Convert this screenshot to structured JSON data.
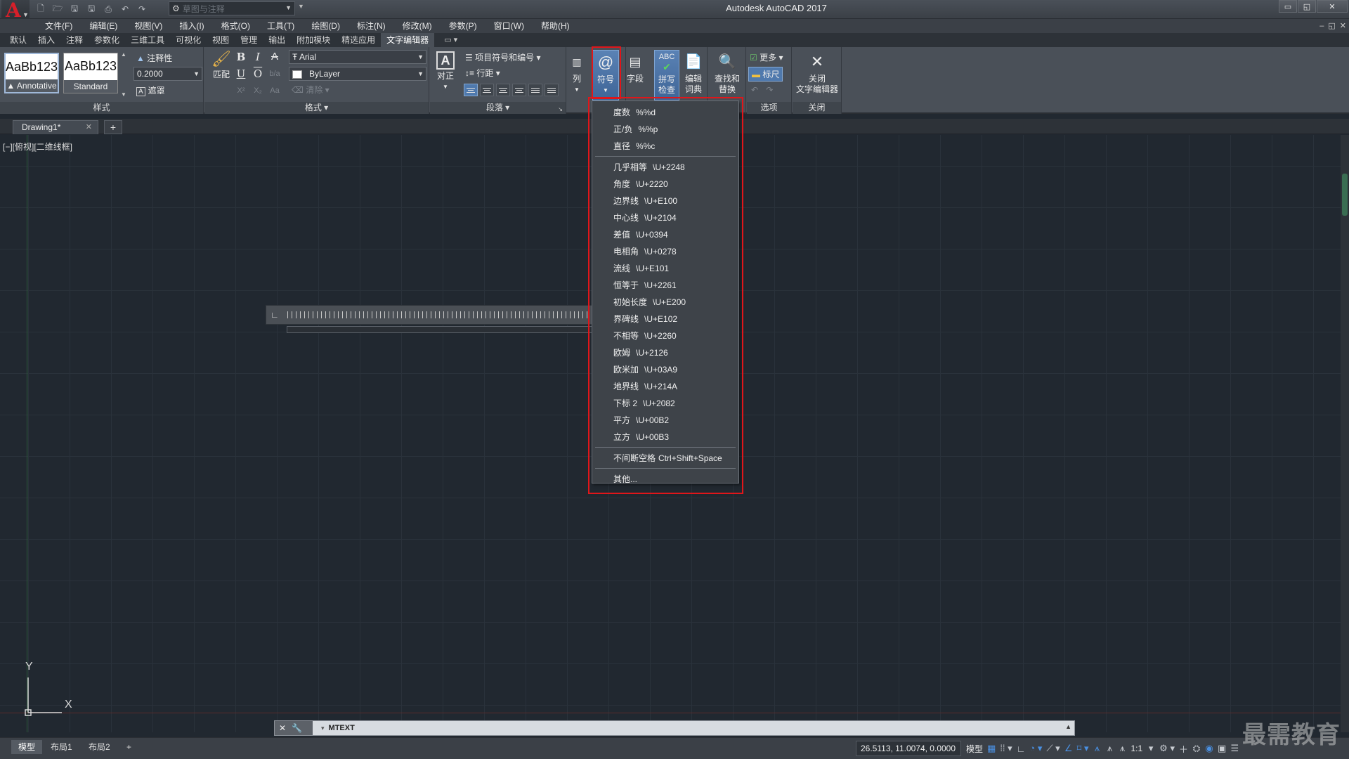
{
  "title_bar": {
    "app_title": "Autodesk AutoCAD 2017",
    "logo_letter": "A",
    "workspace": "草图与注释",
    "window_controls": [
      "▭",
      "◱",
      "✕"
    ]
  },
  "menu": [
    "文件(F)",
    "编辑(E)",
    "视图(V)",
    "插入(I)",
    "格式(O)",
    "工具(T)",
    "绘图(D)",
    "标注(N)",
    "修改(M)",
    "参数(P)",
    "窗口(W)",
    "帮助(H)"
  ],
  "ribbon_tabs": [
    "默认",
    "插入",
    "注释",
    "参数化",
    "三维工具",
    "可视化",
    "视图",
    "管理",
    "输出",
    "附加模块",
    "精选应用",
    "文字编辑器"
  ],
  "ribbon_active_tab": "文字编辑器",
  "ribbon": {
    "style_panel": {
      "title": "样式",
      "swatches": [
        {
          "sample": "AaBb123",
          "name": "Annotative"
        },
        {
          "sample": "AaBb123",
          "name": "Standard"
        }
      ],
      "annotative_label": "注释性",
      "height_value": "0.2000",
      "mask_label": "遮罩"
    },
    "format_panel": {
      "title": "格式 ▾",
      "match_label": "匹配",
      "font": "Arial",
      "color": "ByLayer",
      "bold": "B",
      "italic": "I",
      "strike": "A",
      "underline": "U",
      "overline": "O",
      "clear_label": "清除"
    },
    "paragraph_panel": {
      "title": "段落 ▾",
      "justify_label": "对正",
      "bullets_label": "项目符号和编号",
      "line_spacing_label": "行距"
    },
    "insert_panel": {
      "column_label": "列",
      "symbol_label": "符号",
      "field_label": "字段"
    },
    "spell_panel": {
      "spell_label_1": "拼写",
      "spell_label_2": "检查",
      "dict_label_1": "编辑",
      "dict_label_2": "词典"
    },
    "tools_panel": {
      "find_label_1": "查找和",
      "find_label_2": "替换"
    },
    "options_panel": {
      "title": "选项",
      "more_label": "更多",
      "ruler_label": "标尺"
    },
    "close_panel": {
      "title": "关闭",
      "close_label_1": "关闭",
      "close_label_2": "文字编辑器"
    }
  },
  "file_tab": {
    "name": "Drawing1*"
  },
  "viewport_label": "[−][俯视][二维线框]",
  "ucs": {
    "y": "Y",
    "x": "X"
  },
  "symbol_menu": {
    "group1": [
      {
        "name": "度数",
        "code": "%%d"
      },
      {
        "name": "正/负",
        "code": "%%p"
      },
      {
        "name": "直径",
        "code": "%%c"
      }
    ],
    "group2": [
      {
        "name": "几乎相等",
        "code": "\\U+2248"
      },
      {
        "name": "角度",
        "code": "\\U+2220"
      },
      {
        "name": "边界线",
        "code": "\\U+E100"
      },
      {
        "name": "中心线",
        "code": "\\U+2104"
      },
      {
        "name": "差值",
        "code": "\\U+0394"
      },
      {
        "name": "电相角",
        "code": "\\U+0278"
      },
      {
        "name": "流线",
        "code": "\\U+E101"
      },
      {
        "name": "恒等于",
        "code": "\\U+2261"
      },
      {
        "name": "初始长度",
        "code": "\\U+E200"
      },
      {
        "name": "界碑线",
        "code": "\\U+E102"
      },
      {
        "name": "不相等",
        "code": "\\U+2260"
      },
      {
        "name": "欧姆",
        "code": "\\U+2126"
      },
      {
        "name": "欧米加",
        "code": "\\U+03A9"
      },
      {
        "name": "地界线",
        "code": "\\U+214A"
      },
      {
        "name": "下标 2",
        "code": "\\U+2082"
      },
      {
        "name": "平方",
        "code": "\\U+00B2"
      },
      {
        "name": "立方",
        "code": "\\U+00B3"
      }
    ],
    "nbsp": {
      "name": "不间断空格",
      "code": "Ctrl+Shift+Space"
    },
    "other": "其他..."
  },
  "command_line": {
    "text": "MTEXT"
  },
  "status_bar": {
    "layout_tabs": [
      "模型",
      "布局1",
      "布局2"
    ],
    "add_tab": "+",
    "coords": "26.5113, 11.0074, 0.0000",
    "model_label": "模型",
    "scale": "1:1"
  },
  "watermark": "最需教育"
}
